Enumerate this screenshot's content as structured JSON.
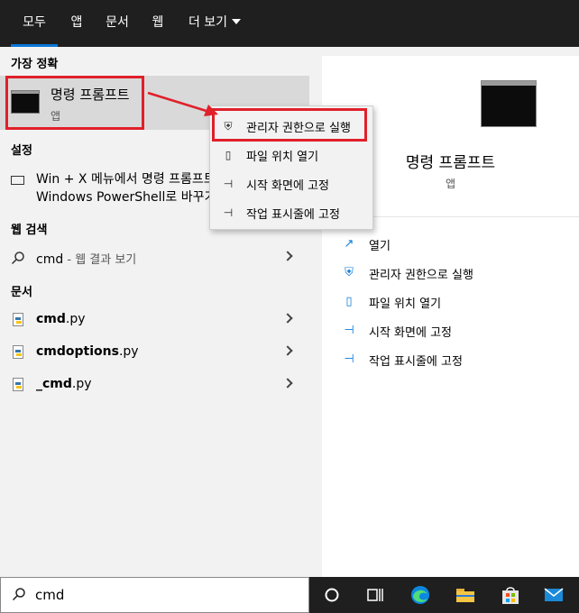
{
  "tabs": [
    {
      "label": "모두",
      "active": true
    },
    {
      "label": "앱"
    },
    {
      "label": "문서"
    },
    {
      "label": "웹"
    },
    {
      "label": "더 보기"
    }
  ],
  "sections": {
    "best_match": "가장 정확",
    "settings": "설정",
    "web_search": "웹 검색",
    "documents": "문서"
  },
  "best_match": {
    "title": "명령 프롬프트",
    "subtitle": "앱",
    "icon": "cmd-icon"
  },
  "setting": {
    "line1": "Win + X 메뉴에서 명령 프롬프트를",
    "line2": "Windows PowerShell로 바꾸기",
    "icon": "monitor-icon"
  },
  "web": {
    "query": "cmd",
    "suffix": " - 웹 결과 보기"
  },
  "documents": [
    {
      "bold": "cmd",
      "rest": ".py"
    },
    {
      "bold": "cmdoptions",
      "rest": ".py"
    },
    {
      "bold": "_cmd",
      "rest": ".py"
    }
  ],
  "context_menu": [
    {
      "label": "관리자 권한으로 실행",
      "icon": "shield-icon"
    },
    {
      "label": "파일 위치 열기",
      "icon": "folder-icon"
    },
    {
      "label": "시작 화면에 고정",
      "icon": "pin-icon"
    },
    {
      "label": "작업 표시줄에 고정",
      "icon": "pin-icon"
    }
  ],
  "preview": {
    "title": "명령 프롬프트",
    "subtitle": "앱",
    "actions": [
      {
        "label": "열기",
        "icon": "open-icon"
      },
      {
        "label": "관리자 권한으로 실행",
        "icon": "shield-icon"
      },
      {
        "label": "파일 위치 열기",
        "icon": "folder-icon"
      },
      {
        "label": "시작 화면에 고정",
        "icon": "pin-icon"
      },
      {
        "label": "작업 표시줄에 고정",
        "icon": "pin-icon"
      }
    ]
  },
  "search": {
    "value": "cmd"
  },
  "colors": {
    "accent": "#0a78d7",
    "highlight": "#e0202a"
  }
}
